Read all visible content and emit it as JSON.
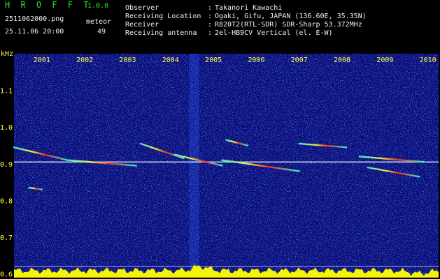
{
  "header": {
    "app_title": "H R O F F T",
    "version": "1.0.0",
    "filename": "2511062000.png",
    "datetime": "25.11.06 20:00",
    "meteor_label": "meteor",
    "meteor_count": "49",
    "info_labels": [
      "Observer",
      "Receiving Location",
      "Receiver",
      "Receiving antenna"
    ],
    "info_sep": ":",
    "info_values": [
      "Takanori Kawachi",
      "Ogaki, Gifu, JAPAN (136.60E, 35.35N)",
      "R820T2(RTL-SDR) SDR-Sharp 53.372MHz",
      "2el-HB9CV Vertical (el. E-W)"
    ]
  },
  "chart_data": {
    "type": "heatmap",
    "ylabel": "kHz",
    "x_tick_labels": [
      "2001",
      "2002",
      "2003",
      "2004",
      "2005",
      "2006",
      "2007",
      "2008",
      "2009",
      "2010"
    ],
    "x_ticks": [
      2001,
      2002,
      2003,
      2004,
      2005,
      2006,
      2007,
      2008,
      2009,
      2010
    ],
    "y_ticks": [
      1.1,
      1.0,
      0.9,
      0.8,
      0.7,
      0.6
    ],
    "y_tick_labels": [
      "1.1",
      "1.0",
      "0.9",
      "0.8",
      "0.7",
      "0.6"
    ],
    "xlim": [
      2000.35,
      2010.25
    ],
    "ylim": [
      0.59,
      1.2
    ],
    "carrier_khz": 0.905,
    "reference_line_khz": 0.62,
    "meteor_echoes": [
      {
        "x0": 2000.35,
        "x1": 2001.6,
        "y0": 0.945,
        "y1": 0.91
      },
      {
        "x0": 2001.6,
        "x1": 2003.2,
        "y0": 0.91,
        "y1": 0.895
      },
      {
        "x0": 2003.3,
        "x1": 2004.3,
        "y0": 0.955,
        "y1": 0.915
      },
      {
        "x0": 2004.1,
        "x1": 2005.2,
        "y0": 0.925,
        "y1": 0.895
      },
      {
        "x0": 2005.2,
        "x1": 2007.0,
        "y0": 0.91,
        "y1": 0.88
      },
      {
        "x0": 2005.3,
        "x1": 2005.8,
        "y0": 0.965,
        "y1": 0.95
      },
      {
        "x0": 2007.0,
        "x1": 2008.1,
        "y0": 0.955,
        "y1": 0.945
      },
      {
        "x0": 2008.4,
        "x1": 2009.9,
        "y0": 0.92,
        "y1": 0.905
      },
      {
        "x0": 2008.6,
        "x1": 2009.8,
        "y0": 0.89,
        "y1": 0.865
      },
      {
        "x0": 2000.7,
        "x1": 2001.0,
        "y0": 0.835,
        "y1": 0.83
      }
    ],
    "colors": {
      "background": "#0a0a7a",
      "carrier": "#e8f0ff",
      "echo_hot": "#ff3020",
      "echo_warm": "#ffff40",
      "echo_cool": "#40ffd0",
      "activity_fill": "#ffff00",
      "baseline": "#40c0ff",
      "label": "#ffff40"
    }
  }
}
